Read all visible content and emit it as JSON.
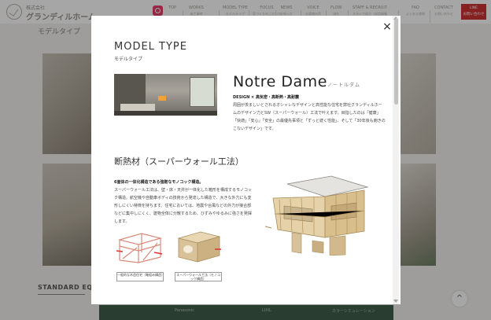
{
  "header": {
    "logo_small": "株式会社",
    "logo_main": "グランディルホーム",
    "nav": [
      {
        "label": "TOP",
        "sub": ""
      },
      {
        "label": "WORKS",
        "sub": "施工事例"
      },
      {
        "label": "MODEL TYPE",
        "sub": "モデルタイプ"
      },
      {
        "label": "FOCUS",
        "sub": "家づくりのこだわり"
      },
      {
        "label": "NEWS",
        "sub": "お知らせ"
      },
      {
        "label": "VOICE",
        "sub": "お客様の声"
      },
      {
        "label": "FLOW",
        "sub": "流れ"
      },
      {
        "label": "STAFF & RECRUIT",
        "sub": "スタッフ紹介・採用情報"
      },
      {
        "label": "FAQ",
        "sub": "よくある質問"
      },
      {
        "label": "CONTACT",
        "sub": "お問い合わせ"
      }
    ],
    "cta_line1": "LINE",
    "cta_line2": "お問い合わせ"
  },
  "page": {
    "title": "モデルタイプ",
    "standard_label": "STANDARD EQU",
    "footer_labels": [
      "Panasonic",
      "LIXIL",
      "カラーシミュレーション"
    ],
    "top_button": "^"
  },
  "modal": {
    "close": "×",
    "title": "MODEL TYPE",
    "subtitle": "モデルタイプ",
    "model_name": "Notre Dame",
    "model_kana": "ノートルダム",
    "tagline": "DESIGN × 高気密・高断熱・高耐震",
    "description": "周囲が羨ましいとされるオシャレなデザインと高性能な住宅を弊社グランディルホームのデザイン力とSW（スーパーウォール）工法で叶えます。目指したのは「健康」「快適」「安心」「安全」の最優先事項と「ずっと続く性能」、そして「30年後も飽きのこないデザイン」です。",
    "section_title": "断熱材（スーパーウォール工法）",
    "section_lead": "6面体の一体化構造である強靭なモノコック構造。",
    "section_desc": "スーパーウォール工法は、壁・床・天井が一体化した箱形を構成するモノコック構造。航空機や自動車ボディの技術から発達した構造で、大きな外力にも変形しにくい特徴を持ちます。住宅においては、地震や台風などの外力が接合部などに集中しにくく、建物全体に分散するため、ひずみやゆるみに強さを発揮します。",
    "caption1": "一般的な木造住宅（軸組み構造）",
    "caption2": "スーパーウォール工法（モノコック構造）"
  }
}
